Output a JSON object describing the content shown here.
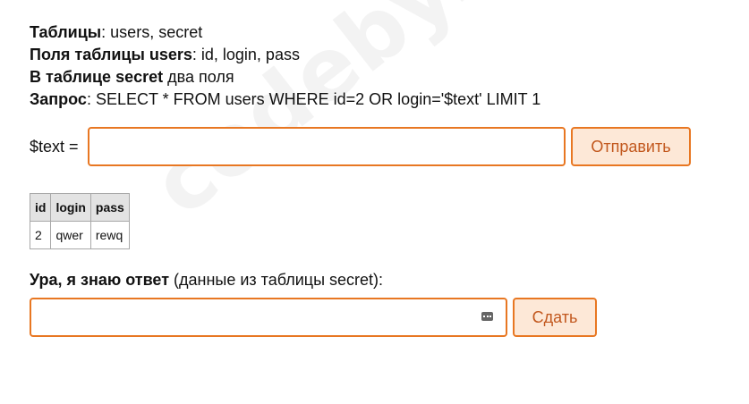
{
  "watermark": "codeby.net",
  "info": {
    "tables_label": "Таблицы",
    "tables_value": ": users, secret",
    "fields_label": "Поля таблицы users",
    "fields_value": ": id, login, pass",
    "secret_label": "В таблице secret",
    "secret_value": " два поля",
    "query_label": "Запрос",
    "query_value": ": SELECT * FROM users WHERE id=2 OR login='$text' LIMIT 1"
  },
  "form": {
    "text_label": "$text =",
    "text_value": "",
    "send_label": "Отправить"
  },
  "table": {
    "headers": [
      "id",
      "login",
      "pass"
    ],
    "rows": [
      [
        "2",
        "qwer",
        "rewq"
      ]
    ]
  },
  "answer": {
    "label_bold": "Ура, я знаю ответ",
    "label_rest": " (данные из таблицы secret):",
    "value": "",
    "input_icon": "keyboard-icon",
    "submit_label": "Сдать"
  },
  "colors": {
    "accent": "#e87722",
    "button_bg": "#fde8d7",
    "button_text": "#c2581e",
    "table_header_bg": "#e3e3e3",
    "watermark": "#f3f3f3"
  }
}
